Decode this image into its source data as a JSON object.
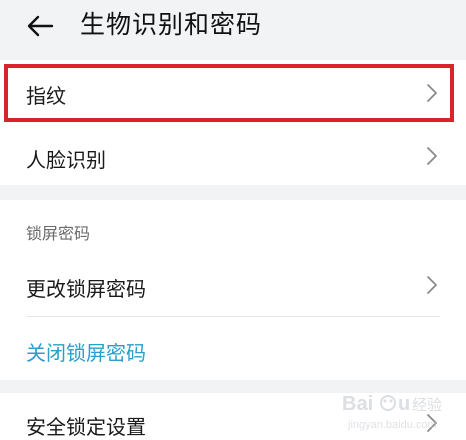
{
  "header": {
    "back_icon": "arrow-left-icon",
    "title": "生物识别和密码"
  },
  "biometrics": {
    "items": [
      {
        "label": "指纹",
        "icon": "chevron-right-icon",
        "highlighted": true
      },
      {
        "label": "人脸识别",
        "icon": "chevron-right-icon"
      }
    ]
  },
  "lock_screen": {
    "section_title": "锁屏密码",
    "change_label": "更改锁屏密码",
    "disable_label": "关闭锁屏密码",
    "link_color": "#2a9fc9"
  },
  "security_lock": {
    "label": "安全锁定设置"
  },
  "colors": {
    "highlight": "#d9232d",
    "background": "#f1f3f5",
    "card": "#ffffff"
  },
  "watermark": {
    "brand": "Baidu 经验",
    "sub": "jingyan.baidu.com"
  }
}
